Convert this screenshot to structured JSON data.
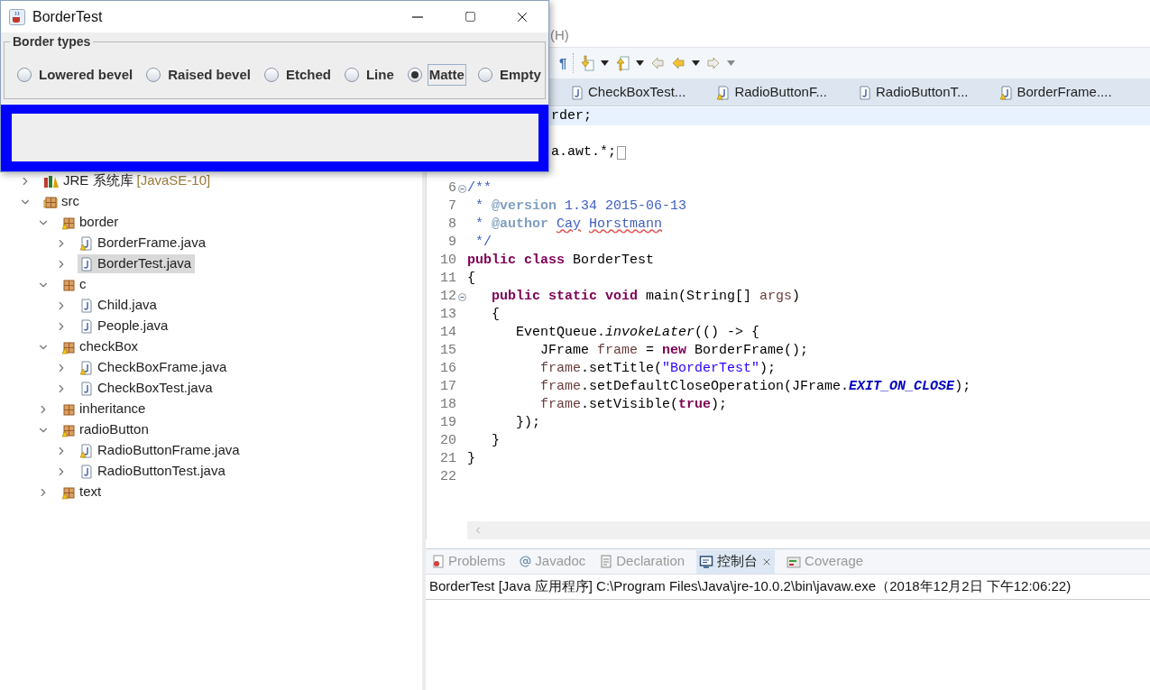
{
  "ide": {
    "menu_fragment": "(H)",
    "toolbar": {
      "glyph": "¶"
    },
    "editor_tabs": [
      {
        "label": "CheckBoxTest...",
        "warning": false
      },
      {
        "label": "RadioButtonF...",
        "warning": true
      },
      {
        "label": "RadioButtonT...",
        "warning": false
      },
      {
        "label": "BorderFrame....",
        "warning": true
      }
    ],
    "tree": [
      {
        "label": "JRE 系统库",
        "suffix": "[JavaSE-10]",
        "kind": "library",
        "expanded": false,
        "selected": false,
        "warning": false
      },
      {
        "label": "src",
        "kind": "source",
        "expanded": true,
        "selected": false,
        "warning": false,
        "children": [
          {
            "label": "border",
            "kind": "package",
            "expanded": true,
            "selected": false,
            "warning": true,
            "children": [
              {
                "label": "BorderFrame.java",
                "kind": "file",
                "expanded": false,
                "selected": false,
                "warning": true
              },
              {
                "label": "BorderTest.java",
                "kind": "file",
                "expanded": false,
                "selected": true,
                "warning": false
              }
            ]
          },
          {
            "label": "c",
            "kind": "package",
            "expanded": true,
            "selected": false,
            "warning": false,
            "children": [
              {
                "label": "Child.java",
                "kind": "file",
                "expanded": false,
                "selected": false,
                "warning": false
              },
              {
                "label": "People.java",
                "kind": "file",
                "expanded": false,
                "selected": false,
                "warning": false
              }
            ]
          },
          {
            "label": "checkBox",
            "kind": "package",
            "expanded": true,
            "selected": false,
            "warning": true,
            "children": [
              {
                "label": "CheckBoxFrame.java",
                "kind": "file",
                "expanded": false,
                "selected": false,
                "warning": true
              },
              {
                "label": "CheckBoxTest.java",
                "kind": "file",
                "expanded": false,
                "selected": false,
                "warning": false
              }
            ]
          },
          {
            "label": "inheritance",
            "kind": "package",
            "expanded": false,
            "selected": false,
            "warning": false
          },
          {
            "label": "radioButton",
            "kind": "package",
            "expanded": true,
            "selected": false,
            "warning": true,
            "children": [
              {
                "label": "RadioButtonFrame.java",
                "kind": "file",
                "expanded": false,
                "selected": false,
                "warning": true
              },
              {
                "label": "RadioButtonTest.java",
                "kind": "file",
                "expanded": false,
                "selected": false,
                "warning": false
              }
            ]
          },
          {
            "label": "text",
            "kind": "package",
            "expanded": false,
            "selected": false,
            "warning": true
          }
        ]
      }
    ],
    "fragments": [
      {
        "text": "rder;",
        "current": true,
        "collapsed": false
      },
      {
        "text": "a.awt.*;",
        "current": false,
        "collapsed": true
      }
    ],
    "lines": [
      {
        "number": "6",
        "fold": true,
        "tokens": [
          {
            "t": "/**",
            "kind": "doc"
          }
        ]
      },
      {
        "number": "7",
        "tokens": [
          {
            "t": " * ",
            "kind": "doc"
          },
          {
            "t": "@version",
            "kind": "tag"
          },
          {
            "t": " 1.34 2015-06-13",
            "kind": "doc"
          }
        ]
      },
      {
        "number": "8",
        "tokens": [
          {
            "t": " * ",
            "kind": "doc"
          },
          {
            "t": "@author",
            "kind": "tag"
          },
          {
            "t": " Cay",
            "kind": "spell"
          },
          {
            "t": " Horstmann",
            "kind": "spell"
          }
        ]
      },
      {
        "number": "9",
        "tokens": [
          {
            "t": " */",
            "kind": "doc"
          }
        ]
      },
      {
        "number": "10",
        "tokens": [
          {
            "t": "public class",
            "kind": "kw"
          },
          {
            "t": " BorderTest",
            "kind": "plain"
          }
        ]
      },
      {
        "number": "11",
        "tokens": [
          {
            "t": "{",
            "kind": "plain"
          }
        ]
      },
      {
        "number": "12",
        "fold": true,
        "tokens": [
          {
            "t": "   public static void",
            "kind": "kw"
          },
          {
            "t": " main(String[] ",
            "kind": "plain"
          },
          {
            "t": "args",
            "kind": "var"
          },
          {
            "t": ")",
            "kind": "plain"
          }
        ]
      },
      {
        "number": "13",
        "tokens": [
          {
            "t": "   {",
            "kind": "plain"
          }
        ]
      },
      {
        "number": "14",
        "tokens": [
          {
            "t": "      EventQueue.",
            "kind": "plain"
          },
          {
            "t": "invokeLater",
            "kind": "italic"
          },
          {
            "t": "(() -> {",
            "kind": "plain"
          }
        ]
      },
      {
        "number": "15",
        "tokens": [
          {
            "t": "         JFrame ",
            "kind": "plain"
          },
          {
            "t": "frame",
            "kind": "var"
          },
          {
            "t": " = ",
            "kind": "plain"
          },
          {
            "t": "new",
            "kind": "kw"
          },
          {
            "t": " BorderFrame();",
            "kind": "plain"
          }
        ]
      },
      {
        "number": "16",
        "tokens": [
          {
            "t": "         frame",
            "kind": "var"
          },
          {
            "t": ".setTitle(",
            "kind": "plain"
          },
          {
            "t": "\"BorderTest\"",
            "kind": "str"
          },
          {
            "t": ");",
            "kind": "plain"
          }
        ]
      },
      {
        "number": "17",
        "tokens": [
          {
            "t": "         frame",
            "kind": "var"
          },
          {
            "t": ".setDefaultCloseOperation(JFrame.",
            "kind": "plain"
          },
          {
            "t": "EXIT_ON_CLOSE",
            "kind": "const"
          },
          {
            "t": ");",
            "kind": "plain"
          }
        ]
      },
      {
        "number": "18",
        "tokens": [
          {
            "t": "         frame",
            "kind": "var"
          },
          {
            "t": ".setVisible(",
            "kind": "plain"
          },
          {
            "t": "true",
            "kind": "kw"
          },
          {
            "t": ");",
            "kind": "plain"
          }
        ]
      },
      {
        "number": "19",
        "tokens": [
          {
            "t": "      });",
            "kind": "plain"
          }
        ]
      },
      {
        "number": "20",
        "tokens": [
          {
            "t": "   }",
            "kind": "plain"
          }
        ]
      },
      {
        "number": "21",
        "tokens": [
          {
            "t": "}",
            "kind": "plain"
          }
        ]
      },
      {
        "number": "22"
      }
    ],
    "bottom_tabs": [
      {
        "label": "Problems",
        "kind": "problems",
        "selected": false
      },
      {
        "label": "Javadoc",
        "kind": "javadoc",
        "selected": false
      },
      {
        "label": "Declaration",
        "kind": "declaration",
        "selected": false
      },
      {
        "label": "控制台",
        "kind": "console",
        "selected": true
      },
      {
        "label": "Coverage",
        "kind": "coverage",
        "selected": false
      }
    ],
    "console": "BorderTest [Java 应用程序] C:\\Program Files\\Java\\jre-10.0.2\\bin\\javaw.exe（2018年12月2日 下午12:06:22)"
  },
  "dialog": {
    "title": "BorderTest",
    "group_title": "Border types",
    "options": [
      {
        "label": "Lowered bevel",
        "selected": false
      },
      {
        "label": "Raised bevel",
        "selected": false
      },
      {
        "label": "Etched",
        "selected": false
      },
      {
        "label": "Line",
        "selected": false
      },
      {
        "label": "Matte",
        "selected": true
      },
      {
        "label": "Empty",
        "selected": false
      }
    ]
  }
}
